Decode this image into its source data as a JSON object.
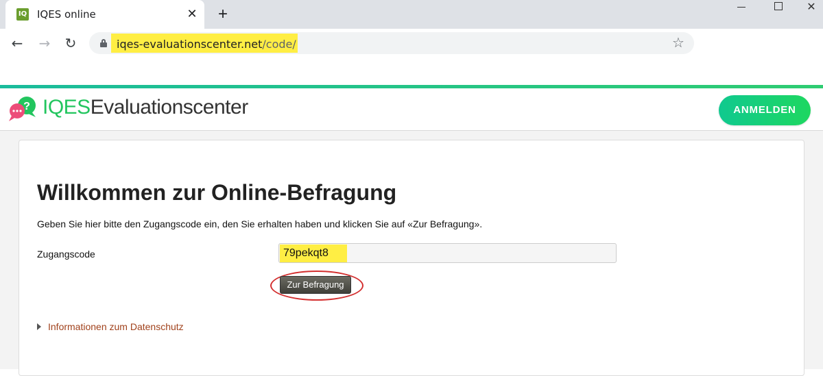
{
  "browser": {
    "tab_title": "IQES online",
    "favicon_text": "IQ",
    "tab_close": "✕",
    "new_tab": "+",
    "url_domain": "iqes-evaluationscenter.net",
    "url_path": "/code/",
    "colors": {
      "url_highlight": "#ffee44"
    }
  },
  "header": {
    "logo_brand": "IQES",
    "logo_sub": "Evaluationscenter",
    "login_label": "ANMELDEN",
    "colors": {
      "accent": "#22c55e",
      "login_button": "#10c98f"
    }
  },
  "main": {
    "title": "Willkommen zur Online-Befragung",
    "intro": "Geben Sie hier bitte den Zugangscode ein, den Sie erhalten haben und klicken Sie auf «Zur Befragung».",
    "code_label": "Zugangscode",
    "code_value": "79pekqt8",
    "submit_label": "Zur Befragung",
    "privacy_link": "Informationen zum Datenschutz",
    "colors": {
      "highlight": "#ffee44",
      "circle": "#d32f2f",
      "link": "#a0411b"
    }
  }
}
